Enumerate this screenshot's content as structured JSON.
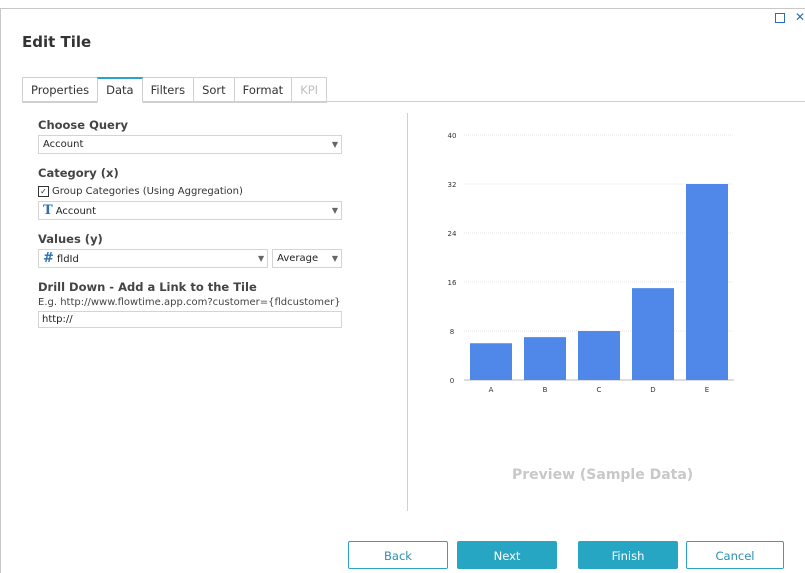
{
  "window": {
    "title": "Edit Tile"
  },
  "tabs": [
    {
      "label": "Properties",
      "active": false,
      "enabled": true
    },
    {
      "label": "Data",
      "active": true,
      "enabled": true
    },
    {
      "label": "Filters",
      "active": false,
      "enabled": true
    },
    {
      "label": "Sort",
      "active": false,
      "enabled": true
    },
    {
      "label": "Format",
      "active": false,
      "enabled": true
    },
    {
      "label": "KPI",
      "active": false,
      "enabled": false
    }
  ],
  "query": {
    "label": "Choose Query",
    "value": "Account"
  },
  "category": {
    "label": "Category (x)",
    "group_checkbox_label": "Group Categories (Using Aggregation)",
    "group_checked": true,
    "value": "Account",
    "type_icon": "T"
  },
  "values": {
    "label": "Values (y)",
    "field": "fldId",
    "type_icon": "#",
    "aggregation": "Average"
  },
  "drilldown": {
    "label": "Drill Down - Add a Link to the Tile",
    "hint": "E.g. http://www.flowtime.app.com?customer={fldcustomer}",
    "value": "http://"
  },
  "preview": {
    "caption": "Preview (Sample Data)"
  },
  "buttons": {
    "back": "Back",
    "next": "Next",
    "finish": "Finish",
    "cancel": "Cancel"
  },
  "colors": {
    "accent": "#27a6c4",
    "bar": "#4f88e8",
    "icon": "#2a6fb0"
  },
  "chart_data": {
    "type": "bar",
    "categories": [
      "A",
      "B",
      "C",
      "D",
      "E"
    ],
    "values": [
      6,
      7,
      8,
      15,
      32
    ],
    "ylim": [
      0,
      40
    ],
    "yticks": [
      0,
      8,
      16,
      24,
      32,
      40
    ],
    "title": "",
    "xlabel": "",
    "ylabel": "",
    "grid": true
  }
}
